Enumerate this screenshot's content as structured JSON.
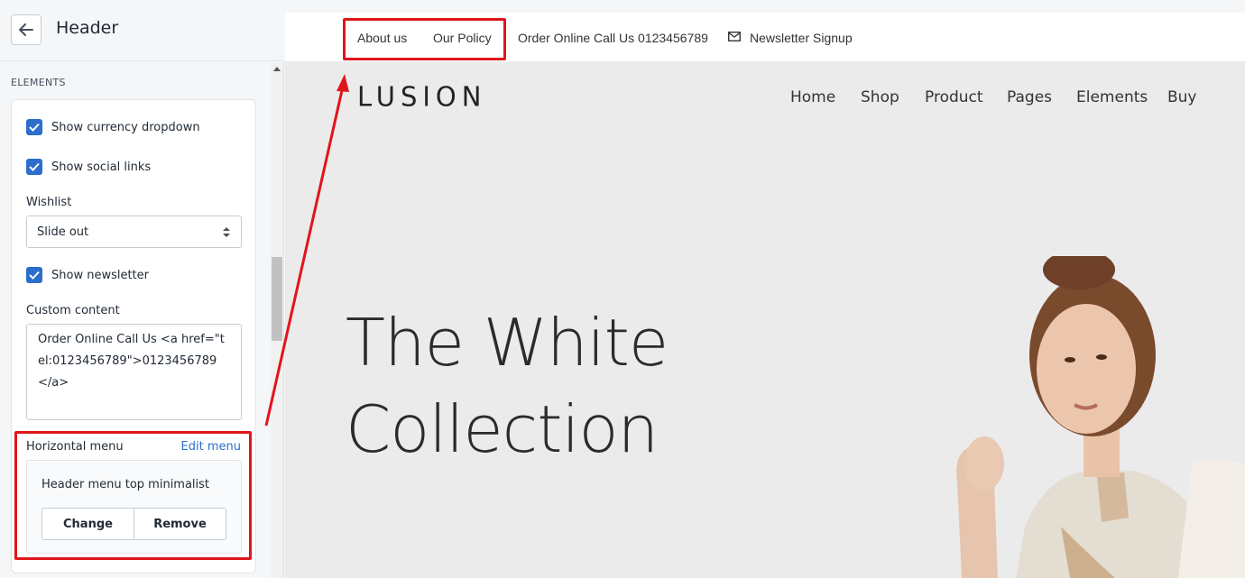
{
  "editor": {
    "title": "Header",
    "section": "ELEMENTS",
    "options": {
      "currency": "Show currency dropdown",
      "social": "Show social links",
      "newsletter": "Show newsletter"
    },
    "wishlist": {
      "label": "Wishlist",
      "value": "Slide out"
    },
    "custom_content": {
      "label": "Custom content",
      "value": "Order Online Call Us <a href=\"tel:0123456789\">0123456789</a>"
    },
    "horizontal_menu": {
      "label": "Horizontal menu",
      "edit": "Edit menu",
      "menu_name": "Header menu top minimalist",
      "change": "Change",
      "remove": "Remove"
    }
  },
  "preview": {
    "topbar": {
      "about": "About us",
      "policy": "Our Policy",
      "order": "Order Online Call Us 0123456789",
      "newsletter": "Newsletter Signup"
    },
    "logo": "LUSION",
    "nav": [
      "Home",
      "Shop",
      "Product",
      "Pages",
      "Elements",
      "Buy"
    ],
    "hero": {
      "line1": "The White",
      "line2": "Collection"
    }
  },
  "colors": {
    "accent": "#2c6ecb",
    "highlight": "#e0151b"
  },
  "icons": [
    "back-arrow-icon",
    "check-icon",
    "select-arrows-icon",
    "mail-icon"
  ]
}
